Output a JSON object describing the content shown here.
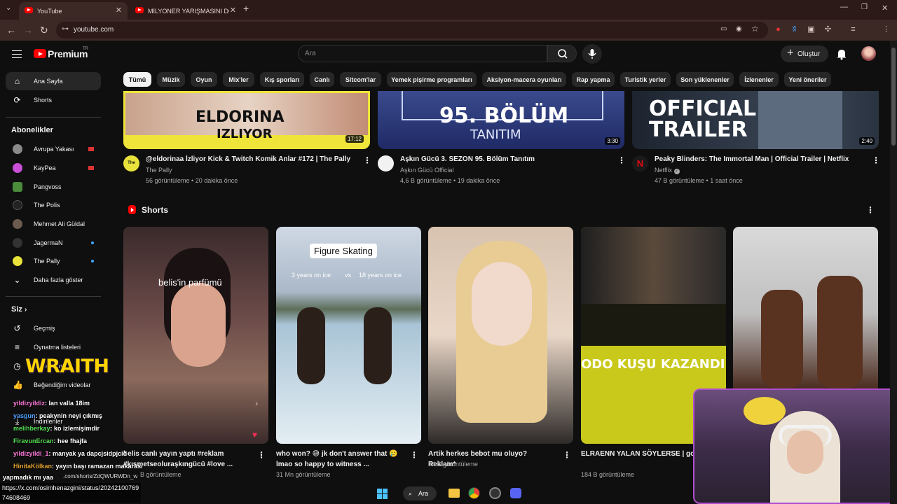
{
  "browser": {
    "tabs": [
      {
        "title": "YouTube",
        "active": true
      },
      {
        "title": "MİLYONER YARIŞMASINI DOLA",
        "active": false
      }
    ],
    "url": "youtube.com"
  },
  "header": {
    "logo_text": "Premium",
    "logo_superscript": "TR",
    "search_placeholder": "Ara",
    "create_label": "Oluştur"
  },
  "sidebar": {
    "main_items": [
      {
        "label": "Ana Sayfa",
        "icon": "home-icon",
        "active": true
      },
      {
        "label": "Shorts",
        "icon": "shorts-icon",
        "active": false
      }
    ],
    "subscriptions_heading": "Abonelikler",
    "subscriptions": [
      {
        "name": "Avrupa Yakası",
        "color": "#8a8a8a",
        "indicator": "live"
      },
      {
        "name": "KayPea",
        "color": "#c94fd6",
        "indicator": "live"
      },
      {
        "name": "Pangvoss",
        "color": "#4a8b3c",
        "indicator": "none"
      },
      {
        "name": "The Polis",
        "color": "#222222",
        "indicator": "none"
      },
      {
        "name": "Mehmet Ali Güldal",
        "color": "#6b5a4e",
        "indicator": "none"
      },
      {
        "name": "JagermaN",
        "color": "#333333",
        "indicator": "new"
      },
      {
        "name": "The Pally",
        "color": "#e8e23a",
        "indicator": "new"
      }
    ],
    "show_more": "Daha fazla göster",
    "you_heading": "Siz",
    "you_items": [
      {
        "label": "Geçmiş",
        "icon": "history-icon"
      },
      {
        "label": "Oynatma listeleri",
        "icon": "playlists-icon"
      },
      {
        "label": "Videolarınız",
        "icon": "watch-later-icon"
      },
      {
        "label": "Beğendiğim videolar",
        "icon": "like-icon"
      },
      {
        "label": "İndirilenler",
        "icon": "download-icon"
      }
    ]
  },
  "chips": [
    "Tümü",
    "Müzik",
    "Oyun",
    "Mix'ler",
    "Kış sporları",
    "Canlı",
    "Sitcom'lar",
    "Yemek pişirme programları",
    "Aksiyon-macera oyunları",
    "Rap yapma",
    "Turistik yerler",
    "Son yüklenenler",
    "İzlenenler",
    "Yeni öneriler"
  ],
  "videos": [
    {
      "thumb_text_1": "ELDORINA",
      "thumb_text_2": "IZLIYOR",
      "duration": "17:12",
      "title": "@eldorinaa İzliyor Kick & Twitch Komik Anlar #172 | The Pally",
      "channel": "The Pally",
      "meta": "56 görüntüleme • 20 dakika önce",
      "channel_avatar_text": "The Pally"
    },
    {
      "thumb_text_1": "95. BÖLÜM",
      "thumb_text_2": "TANITIM",
      "duration": "3:30",
      "title": "Aşkın Gücü 3. SEZON 95.  Bölüm Tanıtım",
      "channel": "Aşkın Gücü Official",
      "meta": "4,6 B görüntüleme • 19 dakika önce"
    },
    {
      "thumb_text_1": "OFFICIAL",
      "thumb_text_2": "TRAILER",
      "duration": "2:40",
      "title": "Peaky Blinders: The Immortal Man | Official Trailer | Netflix",
      "channel": "Netflix",
      "meta": "47 B görüntüleme • 1 saat önce",
      "channel_avatar_text": "N"
    }
  ],
  "shorts_heading": "Shorts",
  "shorts": [
    {
      "overlay": "belis'in parfümü",
      "title": "belis canlı yayın yaptı #reklam #kısmetseoluraşkıngücü #love ...",
      "views": "B görüntüleme"
    },
    {
      "overlay": "Figure Skating",
      "overlay_sub_left": "3 years on ice",
      "overlay_sub_mid": "vs",
      "overlay_sub_right": "18 years on ice",
      "title": "who won? 😅 jk don't answer that 🥲 lmao so happy to witness ...",
      "views": "31 Mn görüntüleme"
    },
    {
      "overlay": "",
      "title": "Artik herkes bebot mu oluyo? Reklam*",
      "views": "24 B görüntüleme"
    },
    {
      "overlay": "ODO KUŞU KAZANDI",
      "title": "ELRAENN YALAN SÖYLERSE | goose duck #elraenn #shorts",
      "views": "184 B görüntüleme"
    },
    {
      "overlay": "",
      "title": "",
      "views": ""
    }
  ],
  "stream_overlay": {
    "brand": "WRAITH",
    "chat": [
      {
        "user": "yildizyildiz",
        "msg": ": lan valla 18im",
        "color": "#ff7ad9"
      },
      {
        "user": "yasgun",
        "msg": ": peakynin neyi çıkmış",
        "color": "#4fa3ff"
      },
      {
        "user": "melihberkay",
        "msg": ": ko izlemişimdir",
        "color": "#55e055"
      },
      {
        "user": "FiravunErcan",
        "msg": ": hee fhajfa",
        "color": "#55e055"
      },
      {
        "user": "yildizyildi_1",
        "msg": ": manyak ya dapcjsidpjcid",
        "color": "#ff7ad9"
      },
      {
        "user": "HinitaKölkan",
        "msg": ": yayın başı ramazan makarası",
        "color": "#e0a030"
      },
      {
        "user": "",
        "msg": "yapmadık mı yaa",
        "color": "#ffffff"
      }
    ],
    "status_url_1": "https://x.com/osimhenazgini/status/20242100769",
    "status_url_2": "74608469",
    "shorts_link": ".com/shorts/ZdQWURWDn_w"
  },
  "taskbar": {
    "search_label": "Ara"
  }
}
